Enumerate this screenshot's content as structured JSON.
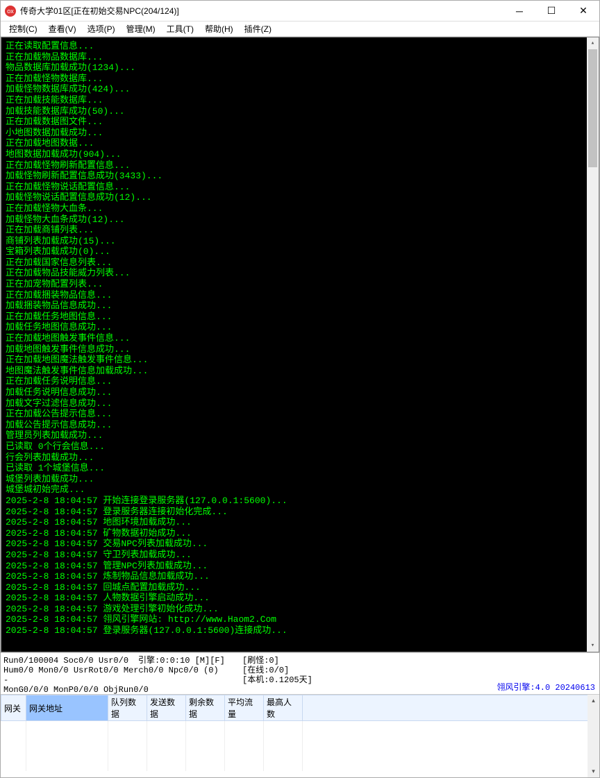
{
  "window": {
    "icon_text": "ox",
    "title": "传奇大学01区[正在初始交易NPC(204/124)]"
  },
  "menu": {
    "control": "控制(C)",
    "view": "查看(V)",
    "options": "选项(P)",
    "manage": "管理(M)",
    "tools": "工具(T)",
    "help": "帮助(H)",
    "plugins": "插件(Z)"
  },
  "console_lines": [
    "正在读取配置信息...",
    "正在加载物品数据库...",
    "物品数据库加载成功(1234)...",
    "正在加载怪物数据库...",
    "加载怪物数据库成功(424)...",
    "正在加载技能数据库...",
    "加载技能数据库成功(50)...",
    "正在加载数据图文件...",
    "小地图数据加载成功...",
    "正在加载地图数据...",
    "地图数据加载成功(904)...",
    "正在加载怪物刷新配置信息...",
    "加载怪物刷新配置信息成功(3433)...",
    "正在加载怪物说话配置信息...",
    "加载怪物说话配置信息成功(12)...",
    "正在加载怪物大血条...",
    "加载怪物大血条成功(12)...",
    "正在加载商铺列表...",
    "商铺列表加载成功(15)...",
    "宝箱列表加载成功(0)...",
    "正在加载国家信息列表...",
    "正在加载物品技能威力列表...",
    "正在加宠物配置列表...",
    "正在加载捆装物品信息...",
    "加载捆装物品信息成功...",
    "正在加载任务地图信息...",
    "加载任务地图信息成功...",
    "正在加载地图触发事件信息...",
    "加载地图触发事件信息成功...",
    "正在加载地图魔法触发事件信息...",
    "地图魔法触发事件信息加载成功...",
    "正在加载任务说明信息...",
    "加载任务说明信息成功...",
    "加载文字过滤信息成功...",
    "正在加载公告提示信息...",
    "加载公告提示信息成功...",
    "管理员列表加载成功...",
    "已读取 0个行会信息...",
    "行会列表加载成功...",
    "已读取 1个城堡信息...",
    "城堡列表加载成功...",
    "城堡城初始完成...",
    "2025-2-8 18:04:57 开始连接登录服务器(127.0.0.1:5600)...",
    "2025-2-8 18:04:57 登录服务器连接初始化完成...",
    "2025-2-8 18:04:57 地图环境加载成功...",
    "2025-2-8 18:04:57 矿物数据初始成功...",
    "2025-2-8 18:04:57 交易NPC列表加载成功...",
    "2025-2-8 18:04:57 守卫列表加载成功...",
    "2025-2-8 18:04:57 管理NPC列表加载成功...",
    "2025-2-8 18:04:57 炼制物品信息加载成功...",
    "2025-2-8 18:04:57 回城点配置加载成功...",
    "2025-2-8 18:04:57 人物数据引擎启动成功...",
    "2025-2-8 18:04:57 游戏处理引擎初始化成功...",
    "2025-2-8 18:04:57 翎风引擎网站: http://www.Haom2.Com",
    "2025-2-8 18:04:57 登录服务器(127.0.0.1:5600)连接成功..."
  ],
  "status": {
    "run": "Run0/100004 Soc0/0 Usr0/0",
    "engine": "引擎:0:0:10 [M][F]",
    "brush": "[刷怪:0]",
    "hum": "Hum0/0 Mon0/0 UsrRot0/0 Merch0/0 Npc0/0 (0)",
    "online": "[在线:0/0]",
    "dash": "-",
    "local": "[本机:0.1205天]",
    "mong": "MonG0/0/0 MonP0/0/0 ObjRun0/0",
    "engine_label": "翎风引擎:4.0 20240613"
  },
  "table": {
    "headers": {
      "gateway": "网关",
      "gateway_addr": "网关地址",
      "queue": "队列数据",
      "send": "发送数据",
      "remain": "剩余数据",
      "avgflow": "平均流量",
      "maxppl": "最高人数"
    }
  }
}
